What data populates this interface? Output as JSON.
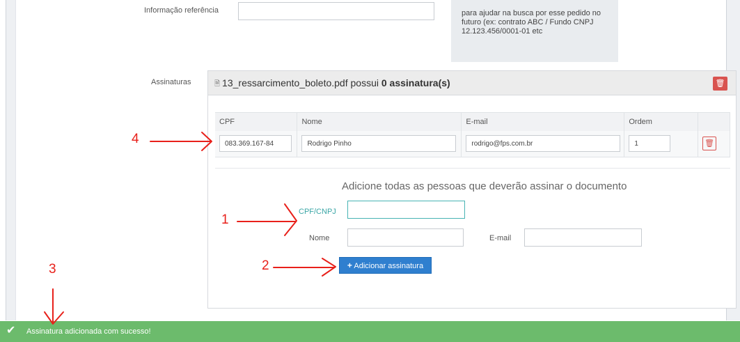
{
  "form": {
    "ref_label": "Informação referência",
    "help_text": "para ajudar na busca por esse pedido no futuro (ex: contrato ABC / Fundo CNPJ 12.123.456/0001-01 etc"
  },
  "signatures": {
    "label": "Assinaturas",
    "filename": "13_ressarcimento_boleto.pdf",
    "possui": "possui",
    "count_text": "0 assinatura(s)",
    "columns": [
      "CPF",
      "Nome",
      "E-mail",
      "Ordem"
    ],
    "rows": [
      {
        "cpf": "083.369.167-84",
        "nome": "Rodrigo Pinho",
        "email": "rodrigo@fps.com.br",
        "ordem": "1"
      }
    ]
  },
  "add_form": {
    "hint": "Adicione todas as pessoas que deverão assinar o documento",
    "cpf_label": "CPF/CNPJ",
    "nome_label": "Nome",
    "email_label": "E-mail",
    "button_label": "Adicionar assinatura"
  },
  "toast": {
    "message": "Assinatura adicionada com sucesso!"
  },
  "annotations": [
    "1",
    "2",
    "3",
    "4"
  ],
  "icons": {
    "pdf": "file-pdf-icon",
    "trash": "trash-icon",
    "plus": "plus-icon",
    "check": "check-icon"
  },
  "colors": {
    "danger": "#d9534f",
    "primary": "#2f7fcf",
    "success": "#6cbb6c",
    "annotation": "#e8201a",
    "focus": "#47b3b3"
  }
}
